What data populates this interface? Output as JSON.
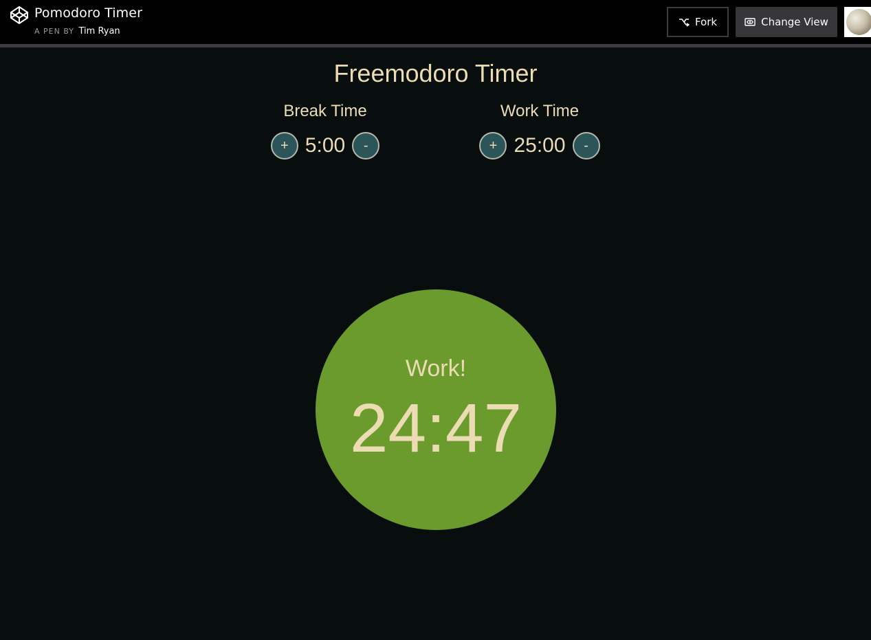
{
  "header": {
    "pen_title": "Pomodoro Timer",
    "pen_by": "A PEN BY",
    "author": "Tim Ryan",
    "fork_label": "Fork",
    "change_view_label": "Change View"
  },
  "app": {
    "title": "Freemodoro Timer",
    "break": {
      "label": "Break Time",
      "value": "5:00",
      "plus": "+",
      "minus": "-"
    },
    "work": {
      "label": "Work Time",
      "value": "25:00",
      "plus": "+",
      "minus": "-"
    },
    "timer": {
      "mode": "Work!",
      "time": "24:47"
    }
  },
  "colors": {
    "background": "#080d0e",
    "text": "#ecdcb4",
    "timer_work": "#6b9b2c",
    "button": "#2b5558"
  },
  "icons": {
    "logo": "codepen-logo-icon",
    "fork": "fork-icon",
    "change_view": "eye-icon"
  }
}
